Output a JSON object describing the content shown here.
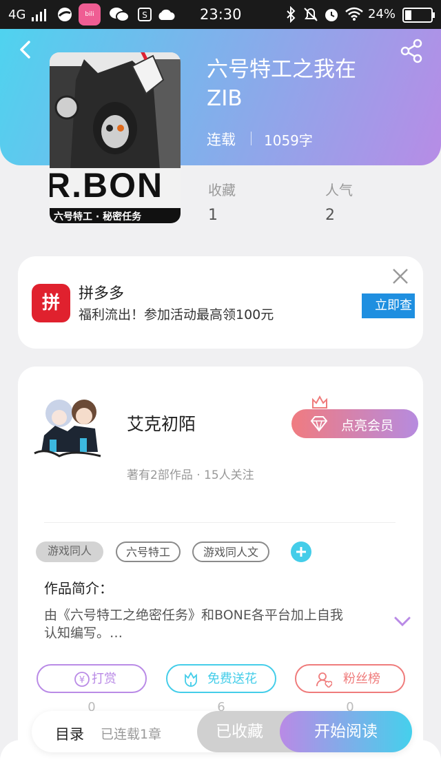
{
  "status": {
    "network": "4G",
    "time": "23:30",
    "battery": "24%"
  },
  "book": {
    "title_line1": "六号特工之我在",
    "title_line2": "ZIB",
    "status": "连载",
    "words": "1059字",
    "favorites_label": "收藏",
    "favorites_value": "1",
    "popularity_label": "人气",
    "popularity_value": "2",
    "cover_text": "R.BON",
    "cover_subtitle": "六号特工 · 秘密任务"
  },
  "ad": {
    "title": "拼多多",
    "desc": "福利流出！参加活动最高领100元",
    "button": "立即查",
    "logo_text": "拼"
  },
  "author": {
    "name": "艾克初陌",
    "stats": "著有2部作品 · 15人关注",
    "vip_label": "点亮会员"
  },
  "tags": [
    "游戏同人",
    "六号特工",
    "游戏同人文"
  ],
  "intro": {
    "label": "作品简介：",
    "text_line1": "由《六号特工之绝密任务》和BONE各平台加上自我",
    "text_line2": "认知编写。…"
  },
  "actions": [
    {
      "label": "打赏",
      "count": "0"
    },
    {
      "label": "免费送花",
      "count": "6"
    },
    {
      "label": "粉丝榜",
      "count": "0"
    }
  ],
  "bottom": {
    "catalog": "目录",
    "chapters": "已连载1章",
    "collected": "已收藏",
    "read": "开始阅读"
  },
  "colors": {
    "purple": "#b98ae6",
    "cyan": "#44cde9",
    "coral": "#ef7b7b",
    "ad_red": "#e0212e",
    "ad_blue": "#1f8fe0"
  }
}
